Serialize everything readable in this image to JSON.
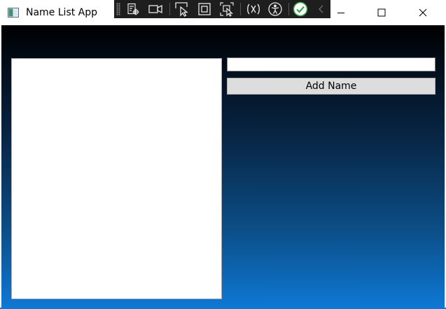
{
  "window": {
    "title": "Name List App",
    "caption_buttons": [
      "minimize-icon",
      "maximize-icon",
      "close-icon"
    ]
  },
  "dev_toolbar": {
    "icons": [
      "select-element-icon",
      "live-preview-icon",
      "pointer-select-icon",
      "display-layout-adorners-icon",
      "track-focus-icon",
      "binding-failures-icon",
      "accessibility-icon",
      "checkmark-icon",
      "collapse-toolbar-icon"
    ],
    "accent_color": "#38a84a"
  },
  "main": {
    "name_input": {
      "value": "",
      "placeholder": ""
    },
    "add_button_label": "Add Name",
    "names_list": []
  },
  "colors": {
    "gradient_top": "#000000",
    "gradient_bottom": "#0e78d4"
  }
}
